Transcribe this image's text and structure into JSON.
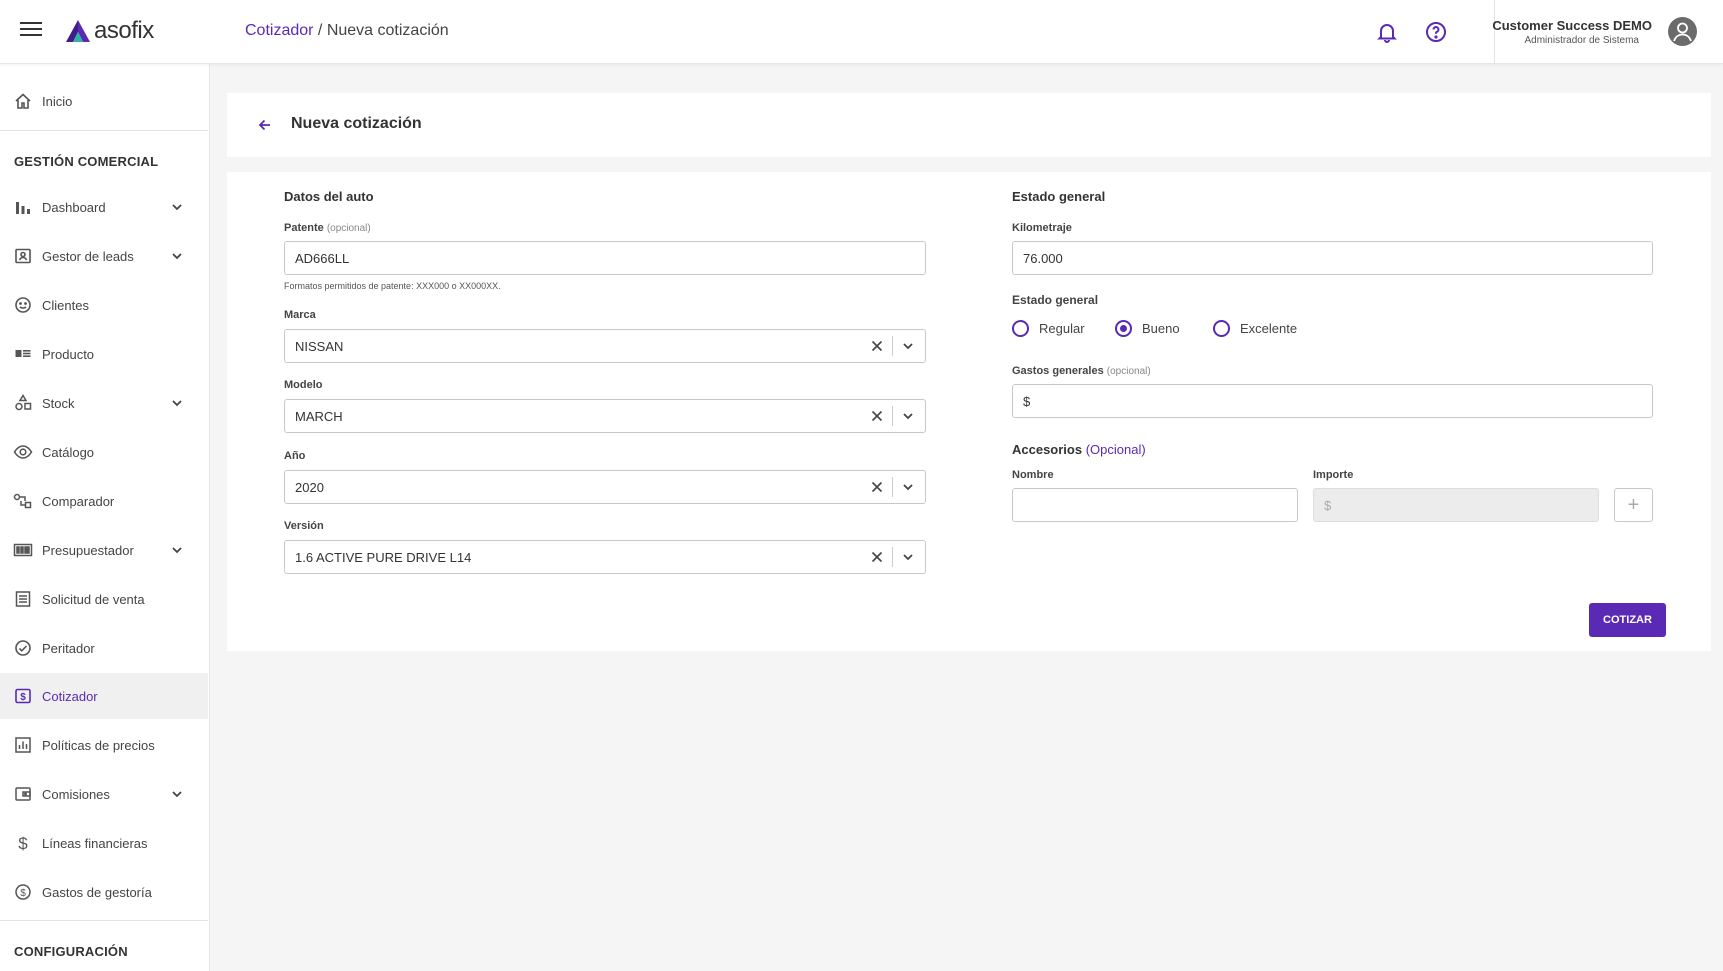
{
  "header": {
    "logo_text": "asofix",
    "breadcrumb_link": "Cotizador",
    "breadcrumb_sep": " / ",
    "breadcrumb_current": "Nueva cotización",
    "user_name": "Customer Success DEMO",
    "user_role": "Administrador de Sistema",
    "accent_color": "#5b2ab5"
  },
  "sidebar": {
    "inicio": "Inicio",
    "section_comercial": "GESTIÓN COMERCIAL",
    "items": [
      {
        "label": "Dashboard",
        "icon": "bar-chart-icon",
        "expandable": true
      },
      {
        "label": "Gestor de leads",
        "icon": "contact-card-icon",
        "expandable": true
      },
      {
        "label": "Clientes",
        "icon": "smiley-icon",
        "expandable": false
      },
      {
        "label": "Producto",
        "icon": "product-list-icon",
        "expandable": false
      },
      {
        "label": "Stock",
        "icon": "shapes-icon",
        "expandable": true
      },
      {
        "label": "Catálogo",
        "icon": "eye-icon",
        "expandable": false
      },
      {
        "label": "Comparador",
        "icon": "compare-icon",
        "expandable": false
      },
      {
        "label": "Presupuestador",
        "icon": "calculator-icon",
        "expandable": true
      },
      {
        "label": "Solicitud de venta",
        "icon": "document-icon",
        "expandable": false
      },
      {
        "label": "Peritador",
        "icon": "check-circle-icon",
        "expandable": false
      },
      {
        "label": "Cotizador",
        "icon": "dollar-box-icon",
        "expandable": false,
        "active": true
      },
      {
        "label": "Políticas de precios",
        "icon": "chart-box-icon",
        "expandable": false
      },
      {
        "label": "Comisiones",
        "icon": "wallet-icon",
        "expandable": true
      },
      {
        "label": "Líneas financieras",
        "icon": "dollar-icon",
        "expandable": false
      },
      {
        "label": "Gastos de gestoría",
        "icon": "dollar-circle-icon",
        "expandable": false
      }
    ],
    "section_config": "CONFIGURACIÓN"
  },
  "page": {
    "title": "Nueva cotización"
  },
  "form": {
    "left_title": "Datos del auto",
    "patente_label": "Patente",
    "optional_tag": "(opcional)",
    "patente_value": "AD666LL",
    "patente_hint": "Formatos permitidos de patente: XXX000 o XX000XX.",
    "marca_label": "Marca",
    "marca_value": "NISSAN",
    "modelo_label": "Modelo",
    "modelo_value": "MARCH",
    "anio_label": "Año",
    "anio_value": "2020",
    "version_label": "Versión",
    "version_value": "1.6 ACTIVE PURE DRIVE L14",
    "right_title": "Estado general",
    "km_label": "Kilometraje",
    "km_value": "76.000",
    "estado_label": "Estado general",
    "estado_options": [
      "Regular",
      "Bueno",
      "Excelente"
    ],
    "estado_selected": "Bueno",
    "gastos_label": "Gastos generales",
    "gastos_value": "$",
    "accesorios_title": "Accesorios",
    "accesorios_opt": "(Opcional)",
    "nombre_label": "Nombre",
    "nombre_value": "",
    "importe_label": "Importe",
    "importe_placeholder": "$",
    "add_label": "+",
    "submit_label": "COTIZAR"
  }
}
